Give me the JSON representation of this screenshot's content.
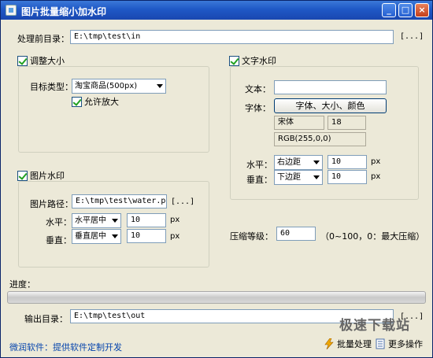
{
  "window": {
    "title": "图片批量缩小加水印"
  },
  "titlebar_buttons": {
    "minimize": "_",
    "maximize": "□",
    "close": "×"
  },
  "input_dir": {
    "label": "处理前目录：",
    "value": "E:\\tmp\\test\\in",
    "browse": "[...]"
  },
  "resize": {
    "checkbox_label": "调整大小",
    "target_label": "目标类型：",
    "target_value": "淘宝商品(500px)",
    "allow_enlarge": "允许放大"
  },
  "image_watermark": {
    "checkbox_label": "图片水印",
    "path_label": "图片路径：",
    "path_value": "E:\\tmp\\test\\water.png",
    "browse": "[...]",
    "h_label": "水平：",
    "h_align": "水平居中",
    "h_value": "10",
    "v_label": "垂直：",
    "v_align": "垂直居中",
    "v_value": "10",
    "unit": "px"
  },
  "text_watermark": {
    "checkbox_label": "文字水印",
    "text_label": "文本：",
    "text_value": "",
    "font_label": "字体：",
    "font_button": "字体、大小、颜色",
    "font_name": "宋体",
    "font_size": "18",
    "font_color": "RGB(255,0,0)",
    "h_label": "水平：",
    "h_align": "右边距",
    "h_value": "10",
    "v_label": "垂直：",
    "v_align": "下边距",
    "v_value": "10",
    "unit": "px"
  },
  "compression": {
    "label": "压缩等级：",
    "value": "60",
    "hint": "（0~100，0：最大压缩）"
  },
  "progress": {
    "label": "进度：",
    "value": 0
  },
  "output_dir": {
    "label": "输出目录：",
    "value": "E:\\tmp\\test\\out",
    "browse": "[...]"
  },
  "footer": {
    "link": "微润软件：提供软件定制开发",
    "batch": "批量处理",
    "more": "更多操作",
    "watermark": "极速下载站"
  },
  "colors": {
    "title_bar": "#1f58c6",
    "window_bg": "#ece9d8",
    "link": "#0645ad",
    "check": "#21a121"
  }
}
